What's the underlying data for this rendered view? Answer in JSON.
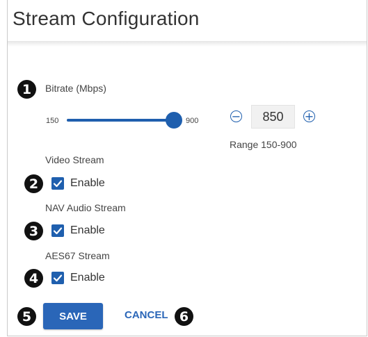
{
  "page": {
    "title": "Stream Configuration"
  },
  "callouts": [
    "1",
    "2",
    "3",
    "4",
    "5",
    "6"
  ],
  "bitrate": {
    "label": "Bitrate (Mbps)",
    "min_label": "150",
    "max_label": "900",
    "min": 150,
    "max": 900,
    "value": 850,
    "value_text": "850",
    "decrement_symbol": "−",
    "increment_symbol": "+",
    "range_text": "Range 150-900"
  },
  "streams": [
    {
      "label": "Video Stream",
      "checkbox_label": "Enable",
      "checked": true
    },
    {
      "label": "NAV Audio Stream",
      "checkbox_label": "Enable",
      "checked": true
    },
    {
      "label": "AES67 Stream",
      "checkbox_label": "Enable",
      "checked": true
    }
  ],
  "actions": {
    "save_label": "SAVE",
    "cancel_label": "CANCEL"
  },
  "colors": {
    "accent": "#1f5fae",
    "button": "#2a66b8",
    "callout": "#111111"
  }
}
